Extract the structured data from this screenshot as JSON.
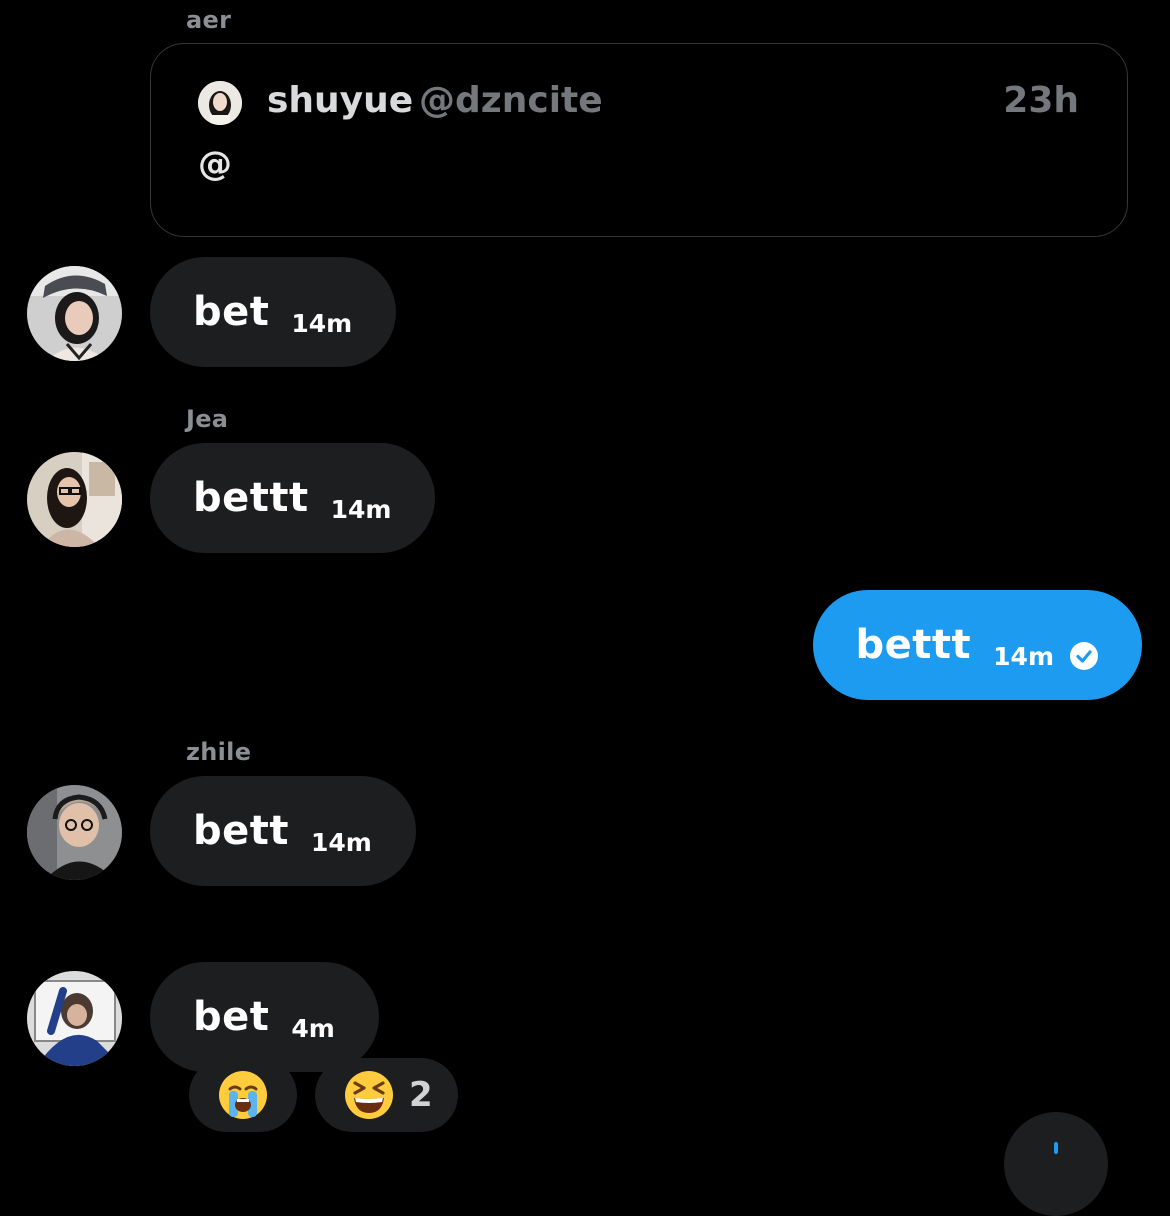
{
  "colors": {
    "background": "#000000",
    "bubble_other": "#1d1e20",
    "bubble_mine": "#1d9bf0",
    "secondary_text": "#8b8e93"
  },
  "quote": {
    "sender_label": "aer",
    "author_name": "shuyue",
    "author_handle": "@dzncite",
    "time": "23h",
    "text": "@"
  },
  "messages": [
    {
      "sender": "",
      "text": "bet",
      "time": "14m",
      "avatar_icon": "avatar-photo"
    },
    {
      "sender": "Jea",
      "text": "bettt",
      "time": "14m",
      "avatar_icon": "avatar-photo"
    },
    {
      "sender": "",
      "text": "bettt",
      "time": "14m",
      "mine": true,
      "status_icon": "sent-check-icon"
    },
    {
      "sender": "zhile",
      "text": "bett",
      "time": "14m",
      "avatar_icon": "avatar-photo"
    },
    {
      "sender": "",
      "text": "bet",
      "time": "4m",
      "avatar_icon": "avatar-photo"
    }
  ],
  "reactions": [
    {
      "emoji": "😭",
      "icon": "loudly-crying-face-emoji",
      "count": ""
    },
    {
      "emoji": "😆",
      "icon": "grinning-squinting-face-emoji",
      "count": "2"
    }
  ]
}
